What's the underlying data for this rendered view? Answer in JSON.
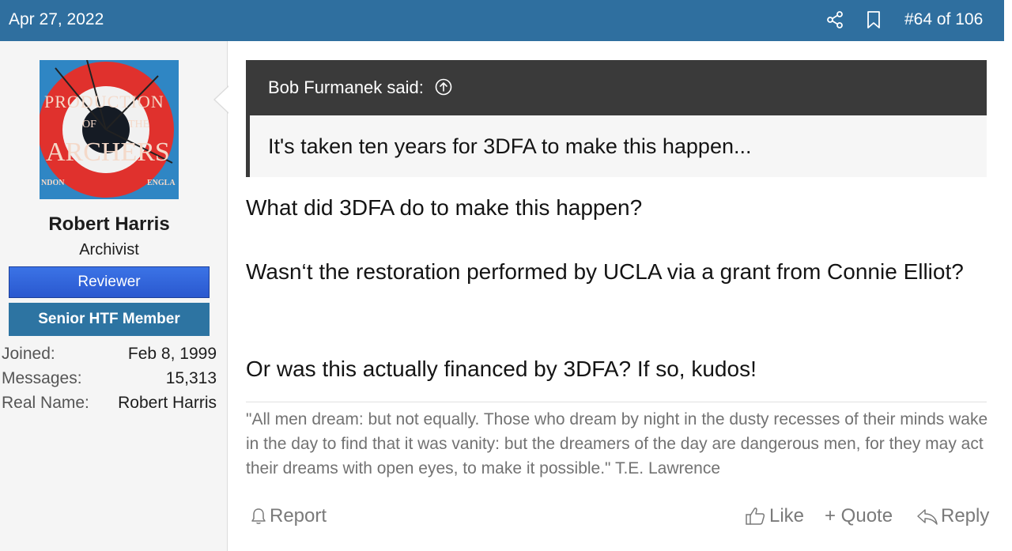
{
  "header": {
    "date": "Apr 27, 2022",
    "post_position": "#64 of 106",
    "share_icon": "share-icon",
    "bookmark_icon": "bookmark-icon",
    "background": "#2f6f9f"
  },
  "user": {
    "avatar_text": {
      "line1": "PRODUCTION",
      "line2a": "OF",
      "line2b": "THE",
      "line3": "ARCHERS",
      "left_bottom": "NDON",
      "right_bottom": "ENGLA"
    },
    "name": "Robert Harris",
    "title": "Archivist",
    "banners": [
      "Reviewer",
      "Senior HTF Member"
    ],
    "stats": [
      {
        "label": "Joined:",
        "value": "Feb 8, 1999"
      },
      {
        "label": "Messages:",
        "value": "15,313"
      },
      {
        "label": "Real Name:",
        "value": "Robert Harris"
      }
    ]
  },
  "quote": {
    "author": "Bob Furmanek said:",
    "text": "It's taken ten years for 3DFA to make this happen..."
  },
  "message": {
    "p1": "What did 3DFA do to make this happen?",
    "p2": "Wasn‘t the restoration performed by UCLA via a grant from Connie Elliot?",
    "p3": "Or was this actually financed by 3DFA? If so, kudos!"
  },
  "signature": "\"All men dream: but not equally. Those who dream by night in the dusty recesses of their minds wake in the day to find that it was vanity: but the dreamers of the day are dangerous men, for they may act their dreams with open eyes, to make it possible.\" T.E. Lawrence",
  "actions": {
    "report": "Report",
    "like": "Like",
    "quote": "+ Quote",
    "reply": "Reply"
  }
}
